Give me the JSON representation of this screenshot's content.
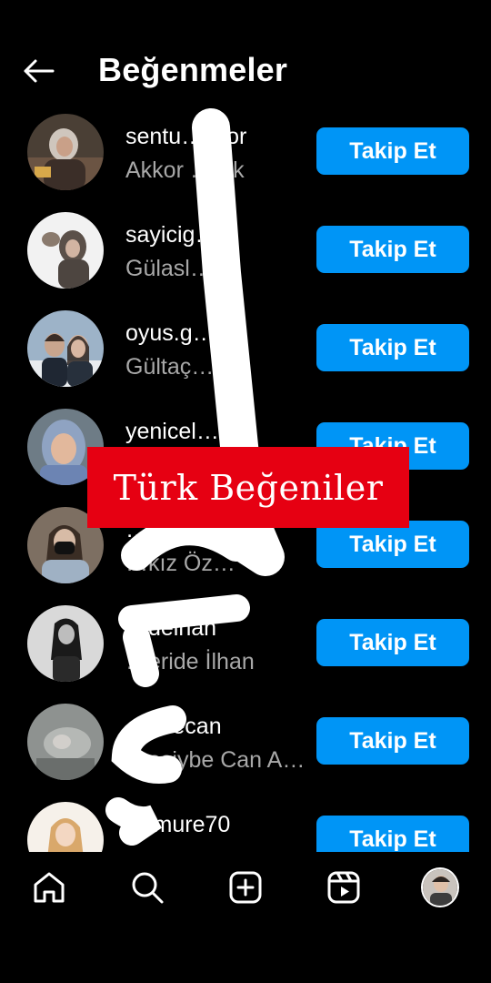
{
  "header": {
    "title": "Beğenmeler",
    "back_icon": "arrow-left-icon"
  },
  "users": [
    {
      "username": "sentu…kkor",
      "fullname": "Akkor …ürk",
      "button": "Takip Et"
    },
    {
      "username": "sayicig…li",
      "fullname": "Gülasl…ıcı",
      "button": "Takip Et"
    },
    {
      "username": "oyus.g…",
      "fullname": "Gültaç…s",
      "button": "Takip Et"
    },
    {
      "username": "yenicel…et",
      "fullname": "",
      "button": "Takip Et"
    },
    {
      "username": "…_ana",
      "fullname": "…kız Öz…",
      "button": "Takip Et"
    },
    {
      "username": "…delhan",
      "fullname": "…eride İlhan",
      "button": "Takip Et"
    },
    {
      "username": "…ybecan",
      "fullname": "…asiybe Can Ak…",
      "button": "Takip Et"
    },
    {
      "username": "…lmure70",
      "fullname": "",
      "button": "Takip Et"
    }
  ],
  "watermark": {
    "text": "Türk Beğeniler",
    "color": "#e60012"
  },
  "colors": {
    "accent": "#0095f6",
    "background": "#000000",
    "secondary_text": "#a8a8a8"
  },
  "nav": {
    "items": [
      "home-icon",
      "search-icon",
      "new-post-icon",
      "reels-icon",
      "profile-avatar"
    ]
  }
}
